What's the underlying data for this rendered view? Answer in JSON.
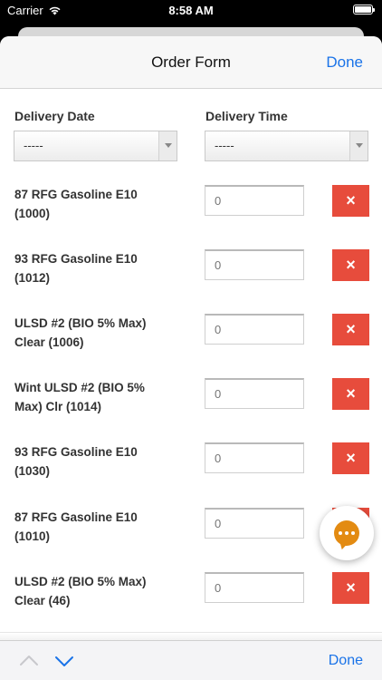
{
  "status_bar": {
    "carrier": "Carrier",
    "time": "8:58 AM"
  },
  "header": {
    "title": "Order Form",
    "done_label": "Done"
  },
  "delivery": {
    "date_label": "Delivery Date",
    "date_value": "-----",
    "time_label": "Delivery Time",
    "time_value": "-----"
  },
  "products": [
    {
      "name": "87 RFG Gasoline E10 (1000)",
      "quantity_placeholder": "0"
    },
    {
      "name": "93 RFG Gasoline E10 (1012)",
      "quantity_placeholder": "0"
    },
    {
      "name": "ULSD #2 (BIO 5% Max) Clear (1006)",
      "quantity_placeholder": "0"
    },
    {
      "name": "Wint ULSD #2 (BIO 5% Max) Clr (1014)",
      "quantity_placeholder": "0"
    },
    {
      "name": "93 RFG Gasoline E10 (1030)",
      "quantity_placeholder": "0"
    },
    {
      "name": "87 RFG Gasoline E10 (1010)",
      "quantity_placeholder": "0"
    },
    {
      "name": "ULSD #2 (BIO 5% Max) Clear (46)",
      "quantity_placeholder": "0"
    }
  ],
  "remove_icon": "×",
  "toolbar": {
    "done_label": "Done"
  },
  "colors": {
    "accent": "#1a73e8",
    "remove": "#e74c3c",
    "chat": "#e38b12"
  }
}
